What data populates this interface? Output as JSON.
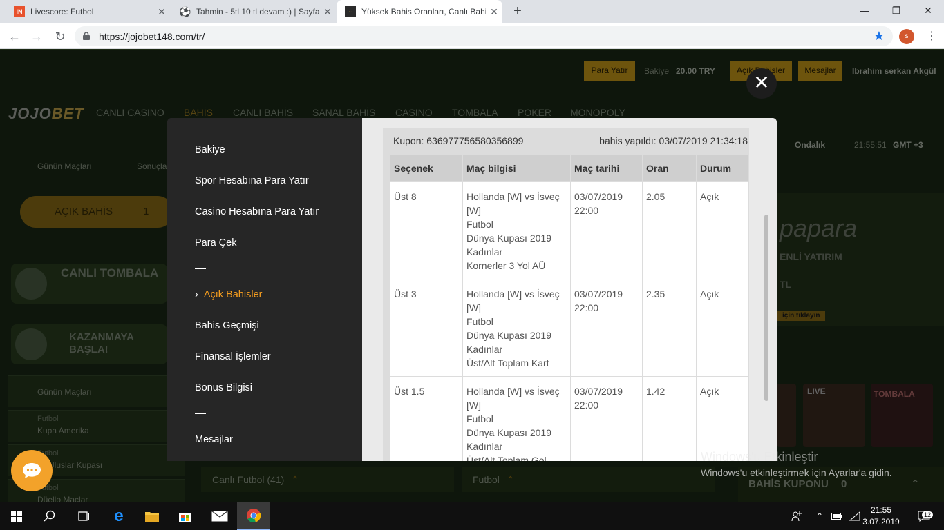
{
  "browser": {
    "tabs": [
      {
        "title": "Livescore: Futbol",
        "icon": "livescore-icon"
      },
      {
        "title": "Tahmin - 5tl 10 tl devam :) | Sayfa",
        "icon": "soccer-ball-icon"
      },
      {
        "title": "Yüksek Bahis Oranları, Canlı Bahis",
        "icon": "jojobet-favicon"
      }
    ],
    "url": "https://jojobet148.com/tr/",
    "profile_initial": "s"
  },
  "site": {
    "logo_main": "JOJO",
    "logo_accent": "BET",
    "header": {
      "deposit_btn": "Para Yatır",
      "balance_label": "Bakiye",
      "balance_value": "20.00 TRY",
      "open_bets_btn": "Açık Bahisler",
      "messages_btn": "Mesajlar",
      "user_name": "Ibrahim serkan Akgül"
    },
    "menu": [
      "CANLI CASINO",
      "BAHİS",
      "CANLI BAHİS",
      "SANAL BAHİS",
      "CASINO",
      "TOMBALA",
      "POKER",
      "MONOPOLY"
    ],
    "subnav": {
      "todays": "Günün Maçları",
      "results": "Sonuçla",
      "odds_format": "Ondalık",
      "time": "21:55:51",
      "timezone": "GMT +3"
    },
    "open_bet_pill": {
      "label": "AÇIK BAHİS",
      "count": "1"
    },
    "banners": [
      "CANLI TOMBALA",
      "KAZANMAYA BAŞLA!"
    ],
    "left_list": [
      {
        "sport": "",
        "name": "Günün Maçları"
      },
      {
        "sport": "Futbol",
        "name": "Kupa Amerika"
      },
      {
        "sport": "Futbol",
        "name": "ka Uluslar Kupası"
      },
      {
        "sport": "Futbol",
        "name": "Düello Maçlar"
      }
    ],
    "promo": {
      "brand": "papara",
      "line": "ENLİ YATIRIM",
      "amount": "TL",
      "cta": "için tıklayın"
    },
    "casino_thumbs": [
      "LIVE",
      "TOMBALA"
    ],
    "bottom": {
      "live_football": "Canlı Futbol (41)",
      "football": "Futbol",
      "coupon": "BAHİS KUPONU",
      "coupon_count": "0"
    }
  },
  "modal": {
    "nav": [
      "Bakiye",
      "Spor Hesabına Para Yatır",
      "Casino Hesabına Para Yatır",
      "Para Çek",
      "Açık Bahisler",
      "Bahis Geçmişi",
      "Finansal İşlemler",
      "Bonus Bilgisi",
      "Mesajlar"
    ],
    "coupon": {
      "label": "Kupon: 636977756580356899",
      "placed": "bahis yapıldı: 03/07/2019 21:34:18"
    },
    "table": {
      "headers": [
        "Seçenek",
        "Maç bilgisi",
        "Maç tarihi",
        "Oran",
        "Durum"
      ],
      "rows": [
        {
          "selection": "Üst 8",
          "info": [
            "Hollanda [W] vs İsveç",
            "[W]",
            "Futbol",
            "Dünya Kupası 2019",
            "Kadınlar",
            "Kornerler 3 Yol AÜ"
          ],
          "date": [
            "03/07/2019",
            "22:00"
          ],
          "odds": "2.05",
          "status": "Açık"
        },
        {
          "selection": "Üst 3",
          "info": [
            "Hollanda [W] vs İsveç",
            "[W]",
            "Futbol",
            "Dünya Kupası 2019",
            "Kadınlar",
            "Üst/Alt Toplam Kart"
          ],
          "date": [
            "03/07/2019",
            "22:00"
          ],
          "odds": "2.35",
          "status": "Açık"
        },
        {
          "selection": "Üst 1.5",
          "info": [
            "Hollanda [W] vs İsveç",
            "[W]",
            "Futbol",
            "Dünya Kupası 2019",
            "Kadınlar",
            "Üst/Alt Toplam Gol"
          ],
          "date": [
            "03/07/2019",
            "22:00"
          ],
          "odds": "1.42",
          "status": "Açık"
        }
      ]
    }
  },
  "watermark": {
    "title": "Windows'u Etkinleştir",
    "subtitle": "Windows'u etkinleştirmek için Ayarlar'a gidin."
  },
  "taskbar": {
    "time": "21:55",
    "date": "3.07.2019",
    "notif_count": "12"
  },
  "colors": {
    "accent_gold": "#c69a19",
    "selected_nav": "#f39c1f",
    "modal_bg": "#232323"
  }
}
